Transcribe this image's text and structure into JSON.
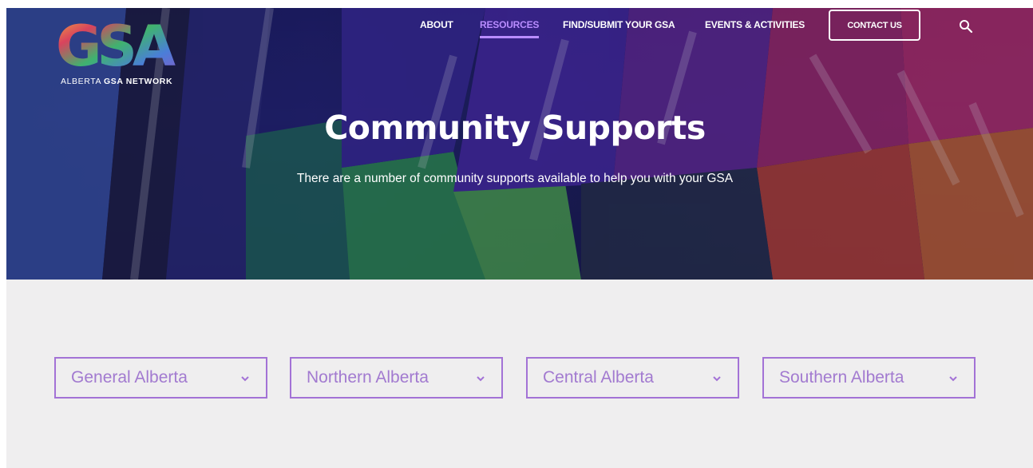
{
  "logo": {
    "letters": "GSA",
    "tagline_prefix": "ALBERTA ",
    "tagline_bold": "GSA NETWORK",
    "colors": [
      "#f4b83a",
      "#d9435d",
      "#3fb36f",
      "#4a7ed8",
      "#8a58c9",
      "#f08a3c"
    ]
  },
  "nav": {
    "items": [
      {
        "label": "ABOUT"
      },
      {
        "label": "RESOURCES",
        "active": true
      },
      {
        "label": "FIND/SUBMIT YOUR GSA"
      },
      {
        "label": "EVENTS & ACTIVITIES"
      }
    ],
    "contact_label": "CONTACT US",
    "search_icon": "search-icon",
    "active_color": "#b98cff"
  },
  "hero": {
    "title": "Community Supports",
    "subtitle": "There are a number of community supports available to help you with your GSA"
  },
  "regions": {
    "accent": "#a372d6",
    "items": [
      {
        "label": "General Alberta",
        "icon": "chevron-down-icon"
      },
      {
        "label": "Northern Alberta",
        "icon": "chevron-down-icon"
      },
      {
        "label": "Central Alberta",
        "icon": "chevron-down-icon"
      },
      {
        "label": "Southern Alberta",
        "icon": "chevron-down-icon"
      }
    ]
  }
}
